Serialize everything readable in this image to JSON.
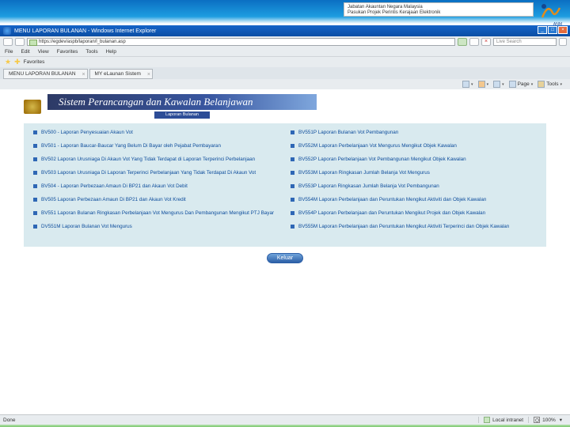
{
  "header": {
    "line1": "Jabatan Akauntan Negara Malaysia",
    "line2": "Pasukan Projek Perintis Kerajaan Elektronik",
    "ag_label": "ANM"
  },
  "ie": {
    "title": "MENU LAPORAN BULANAN - Windows Internet Explorer",
    "address": "https://egdev/aspb/laporan/l_bulanan.asp",
    "search_placeholder": "Live Search",
    "menu": [
      "File",
      "Edit",
      "View",
      "Favorites",
      "Tools",
      "Help"
    ],
    "fav_label": "Favorites",
    "tabs": [
      {
        "label": "MENU LAPORAN BULANAN"
      },
      {
        "label": "MY eLaunan Sistem"
      }
    ],
    "toolbar": {
      "page": "Page",
      "tools": "Tools"
    },
    "status": {
      "left": "Done",
      "zone": "Local intranet",
      "zoom": "100%"
    }
  },
  "page_banner": {
    "title": "Sistem Perancangan dan Kawalan Belanjawan",
    "sub": "Laporan Bulanan"
  },
  "left_items": [
    "BV500 - Laporan Penyesuaian Akaun Vot",
    "BV501 - Laporan Baucar-Baucar Yang Belum Di Bayar oleh Pejabat Pembayaran",
    "BV502 Laporan Urusniaga Di Akaun Vot Yang Tidak Terdapat di Laporan Terperinci Perbelanjaan",
    "BV503 Laporan Urusniaga Di Laporan Terperinci Perbelanjaan Yang Tidak Terdapat Di Akaun Vot",
    "BV504 - Laporan Perbezaan Amaun Di BP21 dan Akaun Vot Debit",
    "BV505 Laporan Perbezaan Amaun Di BP21 dan Akaun Vot Kredit",
    "BV551 Laporan Bulanan Ringkasan Perbelanjaan Vot Mengurus Dan Pembangunan Mengikut PTJ Bayar",
    "DV551M Laporan Bulanan Vot Mengurus"
  ],
  "right_items": [
    "BV551P Laporan Bulanan Vot Pembangunan",
    "BV552M Laporan Perbelanjaan Vot Mengurus Mengikut Objek Kawalan",
    "BV552P Laporan Perbelanjaan Vot Pembangunan Mengikut Objek Kawalan",
    "BV553M Laporan Ringkasan Jumlah Belanja Vot Mengurus",
    "BV553P Laporan Ringkasan Jumlah Belanja Vot Pembangunan",
    "BV554M Laporan Perbelanjaan dan Peruntukan Mengikut Aktiviti dan Objek Kawalan",
    "BV554P Laporan Perbelanjaan dan Peruntukan Mengikut Projek dan Objek Kawalan",
    "BV555M Laporan Perbelanjaan dan Peruntukan Mengikut Aktiviti Terperinci dan Objek Kawalan"
  ],
  "buttons": {
    "keluar": "Keluar"
  }
}
